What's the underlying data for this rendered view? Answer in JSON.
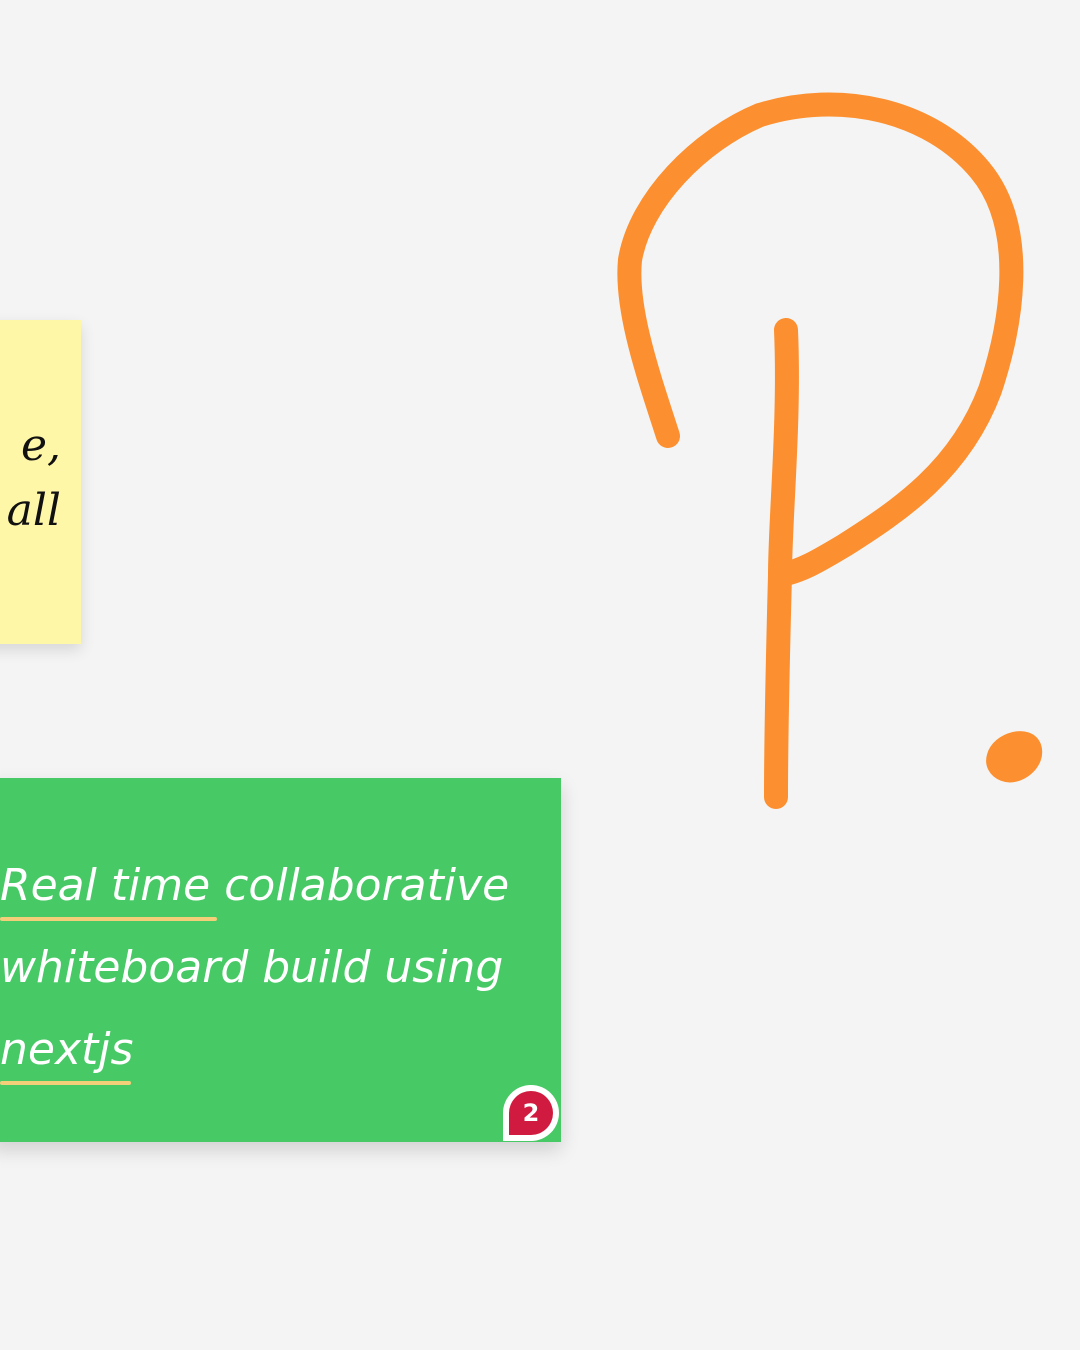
{
  "board": {
    "background_color": "#f4f4f4"
  },
  "yellow_note": {
    "lines": [
      "e,",
      "all"
    ],
    "color": "#fff7a8"
  },
  "green_note": {
    "line1_word1": "Real time",
    "line1_rest": " collaborative",
    "line2": "whiteboard build using",
    "line3": "nextjs",
    "color": "#47c966",
    "underline_color": "#f3cf7a"
  },
  "comment_badge": {
    "count": "2",
    "color": "#d11a3f"
  },
  "drawing": {
    "stroke_color": "#fc8f2f",
    "icon": "hand-drawn-p-icon"
  }
}
